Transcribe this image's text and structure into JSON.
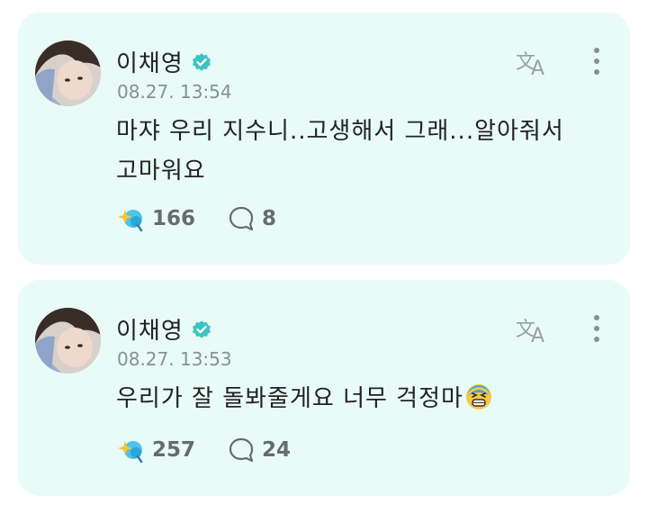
{
  "posts": [
    {
      "author": "이채영",
      "timestamp": "08.27. 13:54",
      "message": "마쟈 우리 지수니..고생해서 그래...알아줘서 고마워요",
      "likes": "166",
      "comments": "8",
      "avatar_icon": "profile-photo",
      "verified_color": "#3cc4c4"
    },
    {
      "author": "이채영",
      "timestamp": "08.27. 13:53",
      "message": "우리가 잘 돌봐줄게요 너무 걱정마",
      "emoji": "anxious-face-emoji",
      "likes": "257",
      "comments": "24",
      "avatar_icon": "profile-photo",
      "verified_color": "#3cc4c4"
    }
  ],
  "icons": {
    "translate": "translate-icon",
    "more": "more-vertical-icon",
    "like": "like-sparkle-icon",
    "comment": "comment-bubble-icon"
  },
  "colors": {
    "card_background": "#e9fbf7",
    "accent": "#3cc4c4",
    "muted_text": "#8a8f93"
  }
}
